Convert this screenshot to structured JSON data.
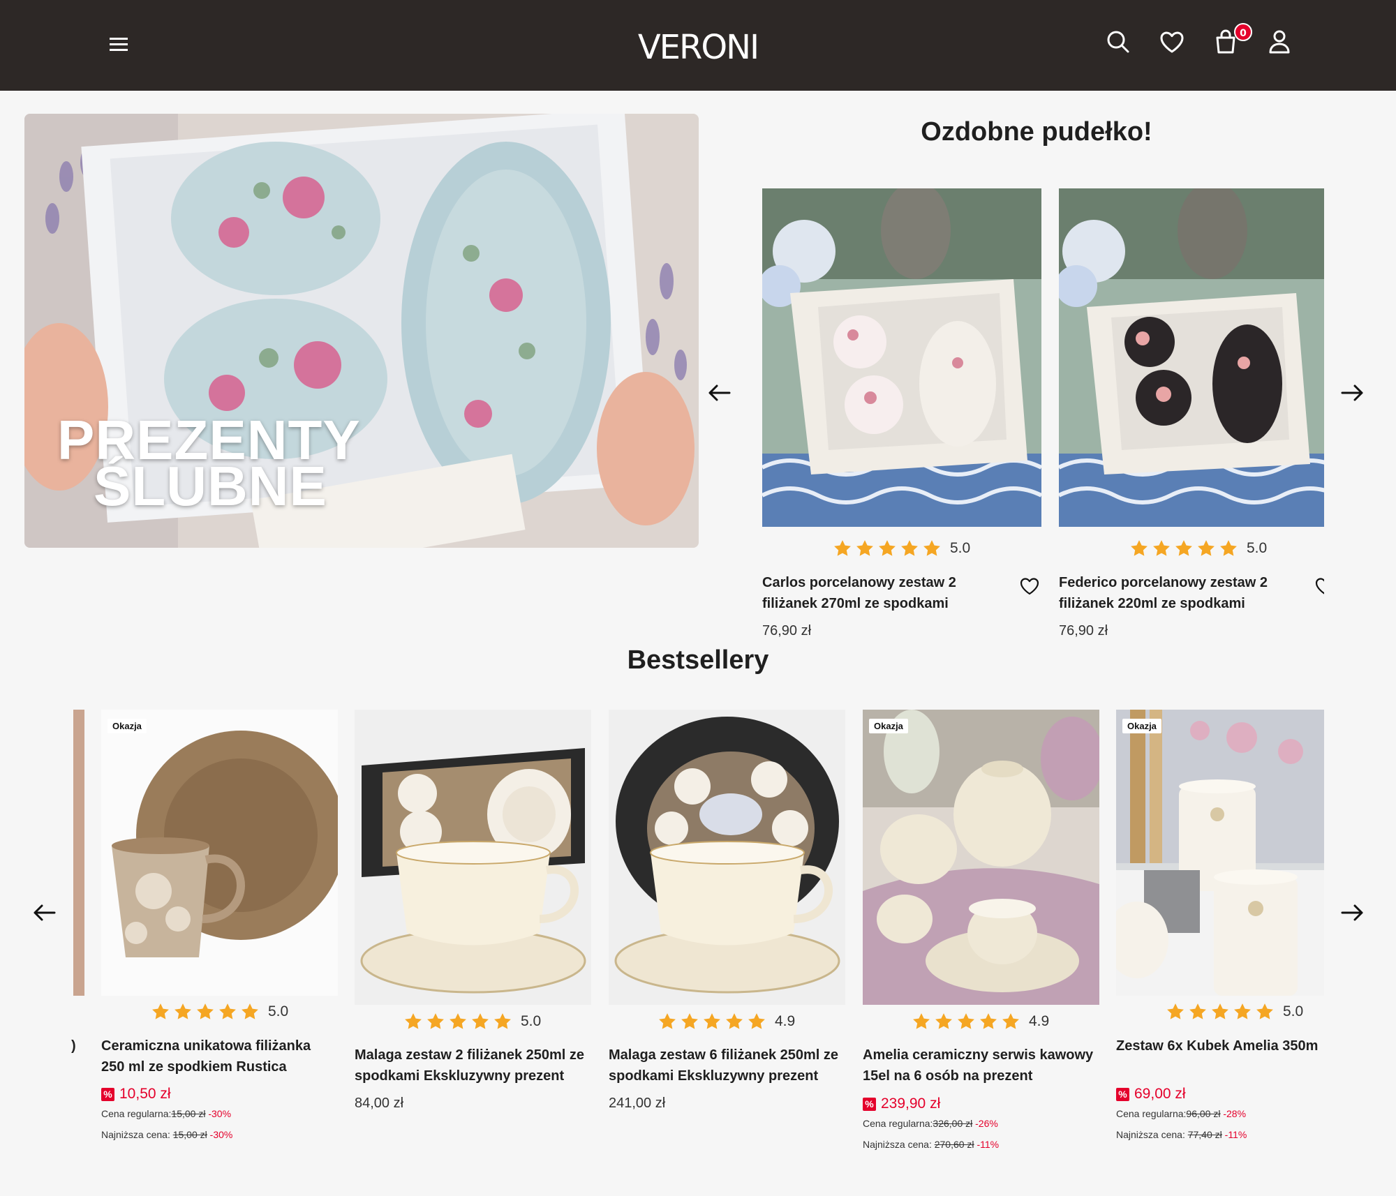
{
  "header": {
    "logo": "VERONI",
    "cart_count": "0"
  },
  "hero": {
    "line1": "PREZENTY",
    "line2": "ŚLUBNE"
  },
  "gift_box": {
    "title": "Ozdobne pudełko!",
    "products": [
      {
        "rating": "5.0",
        "title": "Carlos porcelanowy zestaw 2 filiżanek 270ml ze spodkami",
        "price": "76,90 zł"
      },
      {
        "rating": "5.0",
        "title": "Federico porcelanowy zestaw 2 filiżanek 220ml ze spodkami",
        "price": "76,90 zł"
      }
    ]
  },
  "bestsellers": {
    "title": "Bestsellery",
    "products": [
      {
        "tag": "Okazja",
        "rating": "5.0",
        "title": "Ceramiczna unikatowa filiżanka 250 ml ze spodkiem Rustica",
        "sale_price": "10,50 zł",
        "regular_label": "Cena regularna:",
        "regular_price": "15,00 zł",
        "regular_discount": "-30%",
        "lowest_label": "Najniższa cena:",
        "lowest_price": "15,00 zł",
        "lowest_discount": "-30%"
      },
      {
        "rating": "5.0",
        "title": "Malaga zestaw 2 filiżanek 250ml ze spodkami Ekskluzywny prezent",
        "price": "84,00 zł"
      },
      {
        "rating": "4.9",
        "title": "Malaga zestaw 6 filiżanek 250ml ze spodkami Ekskluzywny prezent",
        "price": "241,00 zł"
      },
      {
        "tag": "Okazja",
        "rating": "4.9",
        "title": "Amelia ceramiczny serwis kawowy 15el na 6 osób na prezent",
        "sale_price": "239,90 zł",
        "regular_label": "Cena regularna:",
        "regular_price": "326,00 zł",
        "regular_discount": "-26%",
        "lowest_label": "Najniższa cena:",
        "lowest_price": "270,60 zł",
        "lowest_discount": "-11%"
      },
      {
        "tag": "Okazja",
        "rating": "5.0",
        "title": "Zestaw 6x Kubek Amelia 350m",
        "sale_price": "69,00 zł",
        "regular_label": "Cena regularna:",
        "regular_price": "96,00 zł",
        "regular_discount": "-28%",
        "lowest_label": "Najniższa cena:",
        "lowest_price": "77,40 zł",
        "lowest_discount": "-11%"
      }
    ]
  },
  "icons": [
    "menu-icon",
    "search-icon",
    "heart-icon",
    "cart-icon",
    "user-icon",
    "arrow-left-icon",
    "arrow-right-icon",
    "star-icon"
  ],
  "colors": {
    "header_bg": "#2d2826",
    "accent_red": "#e4002b",
    "star": "#f5a623"
  }
}
